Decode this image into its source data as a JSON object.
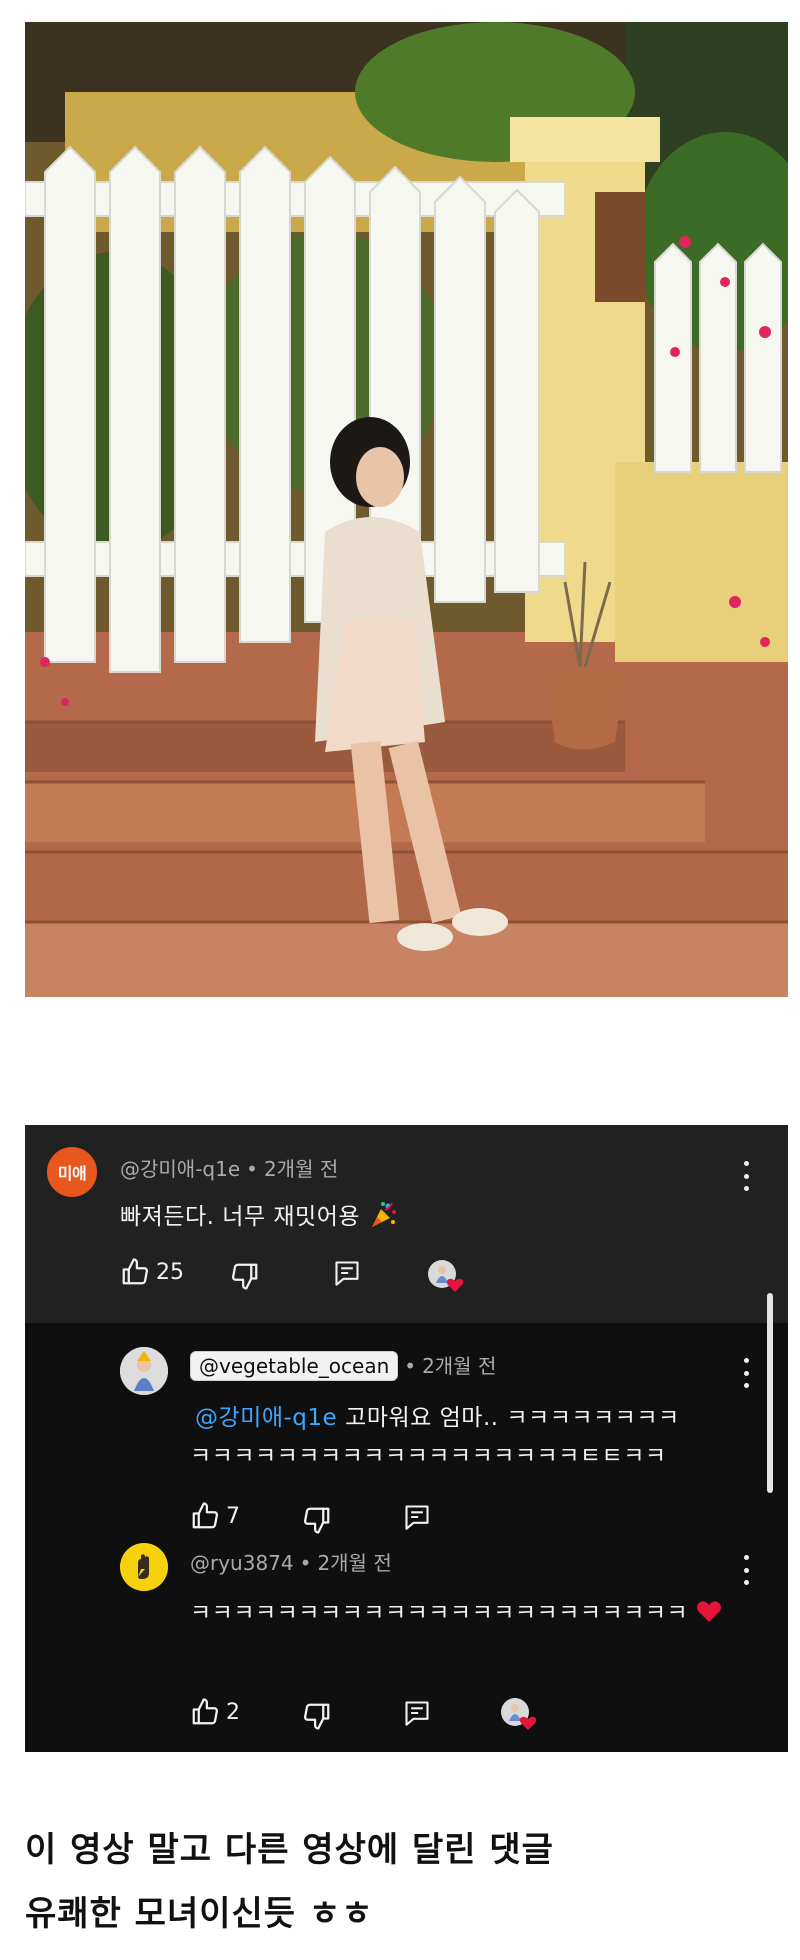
{
  "comments": [
    {
      "avatar_text": "미애",
      "avatar_color": "#e8571e",
      "author": "@강미애-q1e",
      "time": "2개월 전",
      "text": "빠져든다. 너무 재밋어용",
      "emoji": "party-popper-icon",
      "likes": "25"
    },
    {
      "author": "@vegetable_ocean",
      "time": "2개월 전",
      "mention": "@강미애-q1e",
      "text_line1": "고마워요 엄마.. ㅋㅋㅋㅋㅋㅋㅋㅋ",
      "text_line2": "ㅋㅋㅋㅋㅋㅋㅋㅋㅋㅋㅋㅋㅋㅋㅋㅋㅋㅋㅌㅌㅋㅋ",
      "likes": "7"
    },
    {
      "avatar_color": "#f5d20b",
      "author": "@ryu3874",
      "time": "2개월 전",
      "text": "ㅋㅋㅋㅋㅋㅋㅋㅋㅋㅋㅋㅋㅋㅋㅋㅋㅋㅋㅋㅋㅋㅋㅋ",
      "emoji": "heart-icon",
      "likes": "2"
    }
  ],
  "meta_separator": "•",
  "caption": {
    "line1": "이 영상 말고 다른 영상에 달린 댓글",
    "line2": "유쾌한 모녀이신듯 ㅎㅎ"
  },
  "colors": {
    "panel_bg": "#0f0f0f",
    "top_comment_bg": "#212121",
    "mention": "#3ea6ff",
    "heart": "#e3153b"
  }
}
